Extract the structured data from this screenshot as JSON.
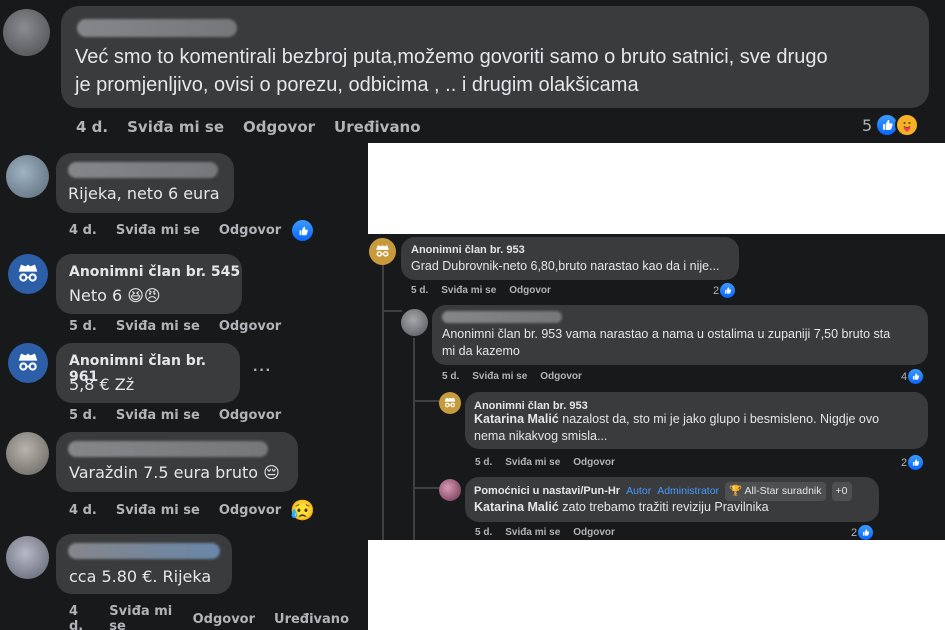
{
  "top_comment": {
    "text_line1": "Već smo to komentirali bezbroj puta,možemo govoriti samo o bruto satnici, sve drugo",
    "text_line2": "je promjenljivo, ovisi o porezu, odbicima , .. i drugim olakšicama",
    "time": "4 d.",
    "like": "Sviđa mi se",
    "reply": "Odgovor",
    "edited": "Uređivano",
    "reaction_count": "5"
  },
  "left_comments": [
    {
      "text": "Rijeka, neto 6 eura",
      "time": "4 d.",
      "like": "Sviđa mi se",
      "reply": "Odgovor"
    },
    {
      "author": "Anonimni član br. 545",
      "text": "Neto 6 😆😠",
      "time": "5 d.",
      "like": "Sviđa mi se",
      "reply": "Odgovor"
    },
    {
      "author": "Anonimni član br. 961",
      "text": "5,8 € Zž",
      "more": "···",
      "time": "5 d.",
      "like": "Sviđa mi se",
      "reply": "Odgovor"
    },
    {
      "text": "Varaždin 7.5 eura bruto 😔",
      "time": "4 d.",
      "like": "Sviđa mi se",
      "reply": "Odgovor",
      "reaction": "😥"
    },
    {
      "text": "cca 5.80 €. Rijeka",
      "time": "4 d.",
      "like": "Sviđa mi se",
      "reply": "Odgovor",
      "edited": "Uređivano"
    }
  ],
  "thread": {
    "c1": {
      "author": "Anonimni član br. 953",
      "text": "Grad Dubrovnik-neto 6,80,bruto narastao kao da i nije...",
      "time": "5 d.",
      "like": "Sviđa mi se",
      "reply": "Odgovor",
      "count": "2"
    },
    "c2": {
      "text_line1": "Anonimni član br. 953 vama narastao a nama u ostalima u zupaniji 7,50 bruto sta",
      "text_line2": "mi da kazemo",
      "time": "5 d.",
      "like": "Sviđa mi se",
      "reply": "Odgovor",
      "count": "4"
    },
    "c3": {
      "author": "Anonimni član br. 953",
      "mention": "Katarina Malić",
      "text_line1": " nazalost da, sto mi je jako glupo i besmisleno. Nigdje ovo",
      "text_line2": "nema nikakvog smisla...",
      "time": "5 d.",
      "like": "Sviđa mi se",
      "reply": "Odgovor",
      "count": "2"
    },
    "c4": {
      "author": "Pomoćnici u nastavi/Pun-Hr",
      "badge_author": "Autor",
      "badge_admin": "Administrator",
      "badge_star": "All-Star suradnik",
      "badge_more": "+0",
      "mention": "Katarina Malić",
      "text": " zato trebamo tražiti reviziju Pravilnika",
      "time": "5 d.",
      "like": "Sviđa mi se",
      "reply": "Odgovor",
      "count": "2"
    }
  },
  "colors": {
    "bg_dark": "#18191a",
    "bubble": "#3a3b3c",
    "text": "#e4e6eb",
    "meta": "#b0b3b8",
    "like_blue": "#0866ff"
  }
}
